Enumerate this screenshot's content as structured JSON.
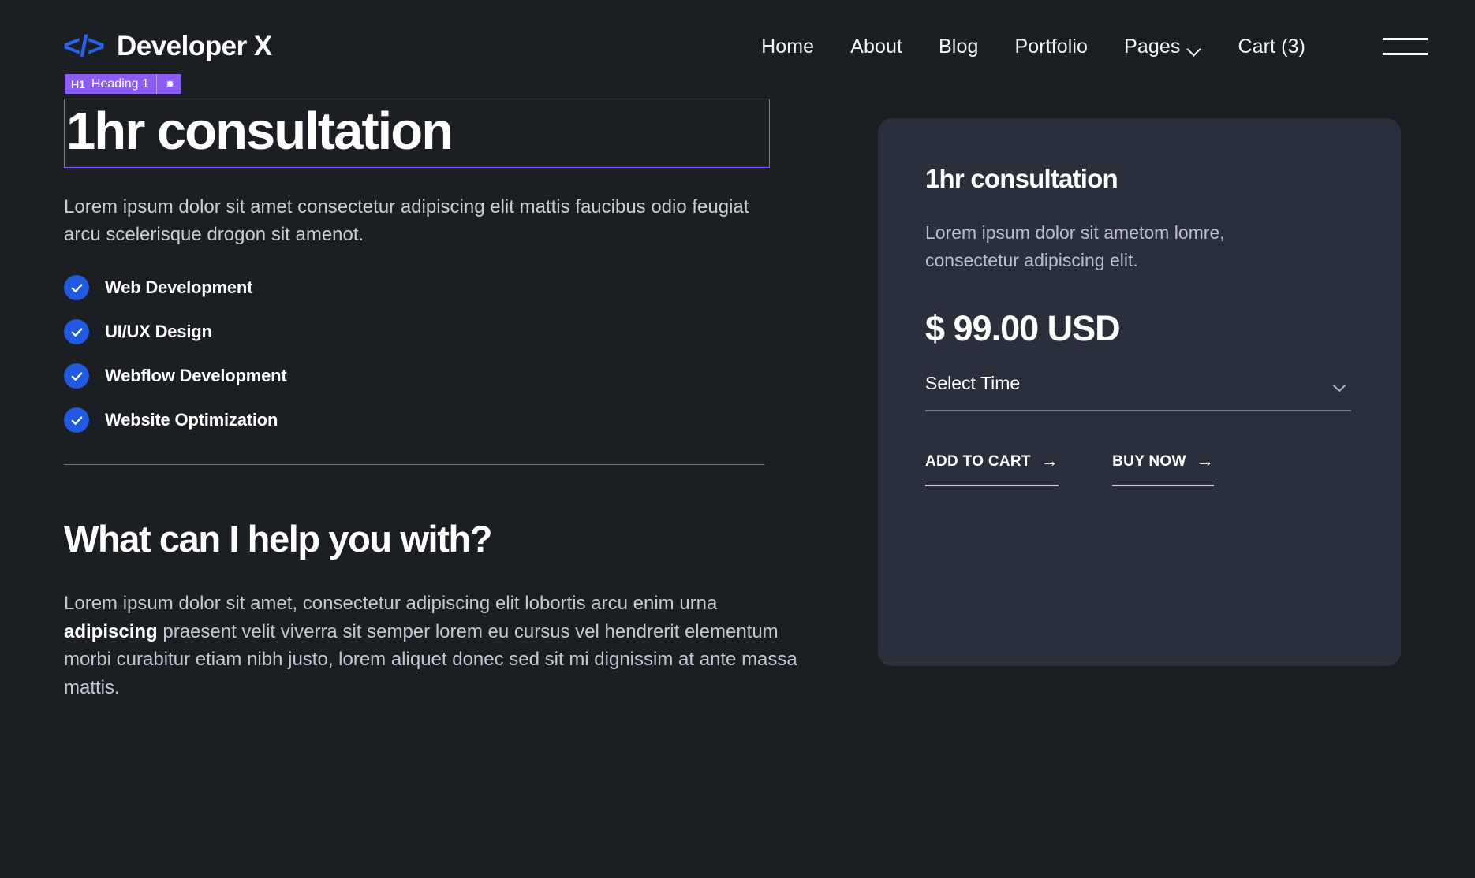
{
  "brand": {
    "mark": "</>",
    "name": "Developer X"
  },
  "nav": {
    "links": [
      {
        "label": "Home"
      },
      {
        "label": "About"
      },
      {
        "label": "Blog"
      },
      {
        "label": "Portfolio"
      },
      {
        "label": "Pages",
        "caret": true
      },
      {
        "label": "Cart (3)"
      }
    ]
  },
  "editor_badge": {
    "tag": "H1",
    "label": "Heading 1",
    "gear": "gear-icon"
  },
  "hero": {
    "heading": "1hr consultation",
    "lead": "Lorem ipsum dolor sit amet consectetur adipiscing elit mattis faucibus odio feugiat arcu scelerisque drogon sit amenot.",
    "features": [
      {
        "label": "Web Development"
      },
      {
        "label": "UI/UX Design"
      },
      {
        "label": "Webflow Development"
      },
      {
        "label": "Website Optimization"
      }
    ]
  },
  "section": {
    "heading": "What can I help you with?",
    "body_part1": "Lorem ipsum dolor sit amet, consectetur adipiscing elit lobortis arcu enim urna ",
    "body_bold": "adipiscing",
    "body_part2": " praesent velit viverra sit semper lorem eu cursus vel hendrerit elementum morbi curabitur etiam nibh justo, lorem aliquet donec sed sit mi dignissim at ante massa mattis."
  },
  "card": {
    "title": "1hr consultation",
    "description": "Lorem ipsum dolor sit ametom lomre, consectetur adipiscing elit.",
    "price": "$ 99.00 USD",
    "select": {
      "value": "Select Time",
      "caret": "chevron-down-icon"
    },
    "add_to_cart": "ADD TO CART",
    "buy_now": "BUY NOW",
    "arrow": "→"
  },
  "colors": {
    "page_bg": "#1b1e23",
    "card_bg": "#2a2f3c",
    "accent_blue": "#2563eb",
    "check_blue": "#1f5ae0",
    "editor_purple": "#8b5cf6",
    "text_primary": "#ffffff",
    "text_muted": "#c3c8d2"
  }
}
